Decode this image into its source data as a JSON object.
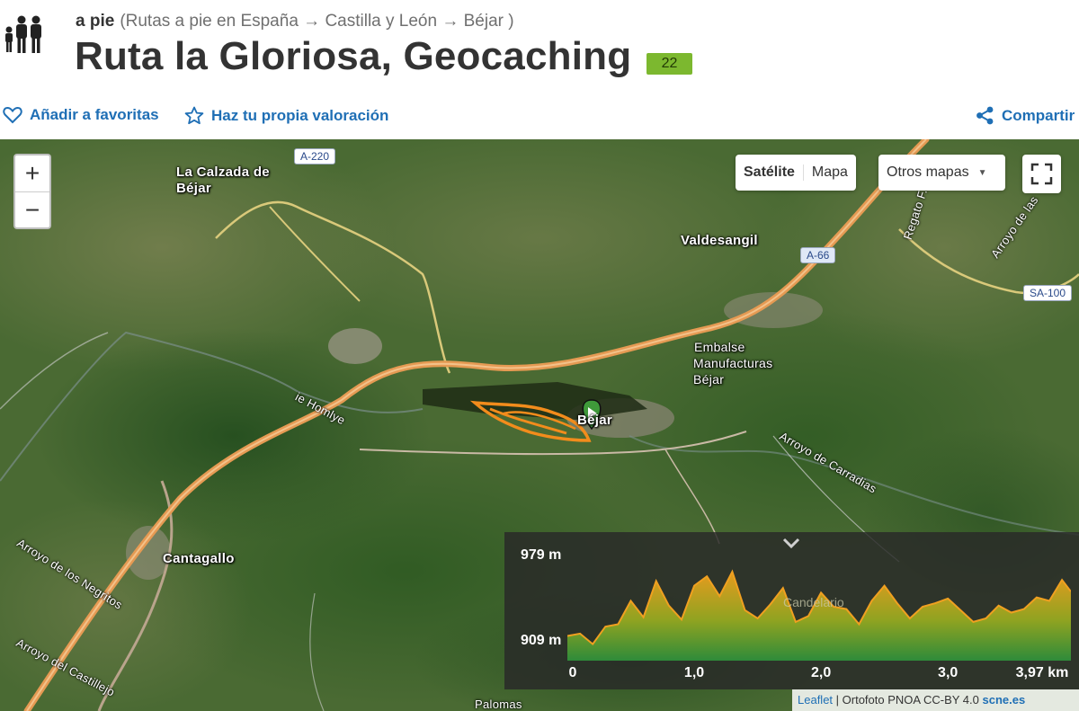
{
  "header": {
    "activity": "a pie",
    "breadcrumb": "(Rutas a pie en España → Castilla y León → Béjar )",
    "title": "Ruta la Gloriosa, Geocaching",
    "score": "22",
    "score_color": "#7cb82f"
  },
  "actions": {
    "favorite": "Añadir a favoritas",
    "rate": "Haz tu propia valoración",
    "share": "Compartir",
    "accent": "#1f6fb5"
  },
  "map": {
    "zoom_in": "+",
    "zoom_out": "−",
    "type_satellite": "Satélite",
    "type_map": "Mapa",
    "other_maps": "Otros mapas",
    "places": {
      "calzada_1": "La Calzada de",
      "calzada_2": "Béjar",
      "valdesangil": "Valdesangil",
      "embalse_1": "Embalse",
      "embalse_2": "Manufacturas",
      "embalse_3": "Béjar",
      "bejar": "Béjar",
      "cantagallo": "Cantagallo",
      "candelario": "Candelario"
    },
    "rivers": {
      "homlye": "ie Homlye",
      "carradias": "Arroyo de Carradias",
      "negritos": "Arroyo de los Negritos",
      "castillejo": "Arroyo del Castillejo",
      "palomas": "Palomas",
      "regato": "Regato F...",
      "arroyo_las": "Arroyo de las"
    },
    "roads": {
      "a220": "A-220",
      "a66": "A-66",
      "sa100": "SA-100"
    },
    "attribution": {
      "leaflet": "Leaflet",
      "text": " | Ortofoto PNOA CC-BY 4.0 ",
      "site": "scne.es"
    }
  },
  "elevation": {
    "max_label": "979 m",
    "min_label": "909 m",
    "x_ticks": [
      "0",
      "1,0",
      "2,0",
      "3,0",
      "3,97 km"
    ]
  },
  "chart_data": {
    "type": "area",
    "title": "",
    "xlabel": "",
    "ylabel": "",
    "xlim": [
      0,
      3.97
    ],
    "ylim": [
      909,
      979
    ],
    "x": [
      0,
      0.1,
      0.2,
      0.3,
      0.4,
      0.5,
      0.6,
      0.7,
      0.8,
      0.9,
      1.0,
      1.1,
      1.2,
      1.3,
      1.4,
      1.5,
      1.6,
      1.7,
      1.8,
      1.9,
      2.0,
      2.1,
      2.2,
      2.3,
      2.4,
      2.5,
      2.6,
      2.7,
      2.8,
      2.9,
      3.0,
      3.1,
      3.2,
      3.3,
      3.4,
      3.5,
      3.6,
      3.7,
      3.8,
      3.9,
      3.97
    ],
    "series": [
      {
        "values": [
          914,
          916,
          907,
          922,
          924,
          944,
          930,
          961,
          940,
          928,
          957,
          965,
          948,
          969,
          936,
          929,
          941,
          955,
          926,
          931,
          951,
          939,
          937,
          924,
          944,
          957,
          942,
          929,
          939,
          942,
          946,
          936,
          926,
          929,
          940,
          934,
          937,
          947,
          944,
          962,
          952
        ]
      }
    ],
    "colors": {
      "line": "#f0a020",
      "fill_top": "#e69b1e",
      "fill_bottom": "#2e8b3a"
    }
  }
}
